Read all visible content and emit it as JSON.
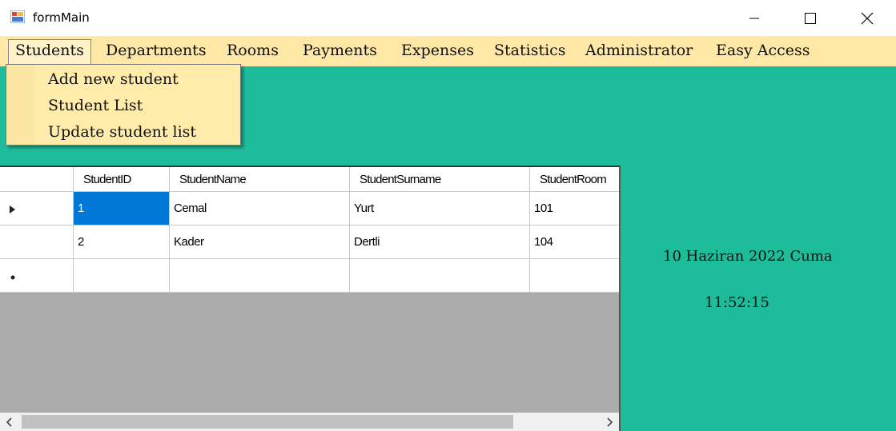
{
  "window": {
    "title": "formMain"
  },
  "menu": {
    "items": [
      "Students",
      "Departments",
      "Rooms",
      "Payments",
      "Expenses",
      "Statistics",
      "Administrator",
      "Easy Access"
    ]
  },
  "students_menu": {
    "items": [
      "Add new student",
      "Student List",
      "Update student list"
    ]
  },
  "grid": {
    "columns": [
      "StudentID",
      "StudentName",
      "StudentSurname",
      "StudentRoom"
    ],
    "rows": [
      [
        "1",
        "Cemal",
        "Yurt",
        "101"
      ],
      [
        "2",
        "Kader",
        "Dertli",
        "104"
      ]
    ]
  },
  "status": {
    "date": "10 Haziran 2022 Cuma",
    "time": "11:52:15"
  },
  "colors": {
    "background": "#1dbc9a",
    "menubar": "#ffe8a6",
    "selection": "#0078d7"
  }
}
